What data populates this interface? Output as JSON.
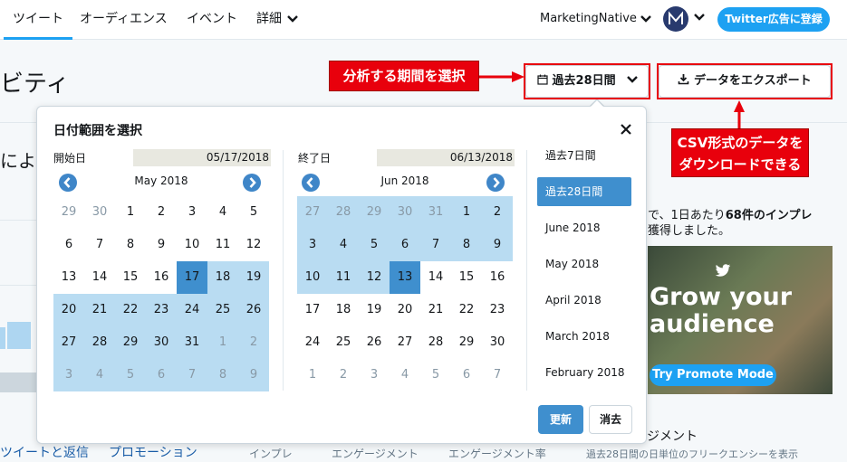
{
  "nav": {
    "tabs": [
      {
        "label": "ツイート"
      },
      {
        "label": "オーディエンス"
      },
      {
        "label": "イベント"
      },
      {
        "label": "詳細"
      }
    ],
    "account": "MarketingNative",
    "ads_button": "Twitter広告に登録"
  },
  "header": {
    "title_partial": "ビティ",
    "range_button": "過去28日間",
    "export_button": "データをエクスポート"
  },
  "callouts": {
    "period": "分析する期間を選択",
    "csv_line1": "CSV形式のデータを",
    "csv_line2": "ダウンロードできる"
  },
  "background": {
    "left_text": "によ",
    "right_line1_a": "で、1日あたり",
    "right_line1_b": "68件のインプレ",
    "right_line2": "獲得しました。",
    "promo_title": "Grow your audience",
    "promo_button": "Try Promote Mode",
    "engagement_partial": "ジメント",
    "bottom_tabs": [
      "ツイートと返信",
      "プロモーション"
    ],
    "bottom_headers": [
      "インプレ",
      "エンゲージメント",
      "エンゲージメント率"
    ],
    "bottom_right": "過去28日間の日単位のフリークエンシーを表示"
  },
  "picker": {
    "title": "日付範囲を選択",
    "start_label": "開始日",
    "start_value": "05/17/2018",
    "end_label": "終了日",
    "end_value": "06/13/2018",
    "start_month": "May 2018",
    "end_month": "Jun 2018",
    "start_days": [
      [
        {
          "d": "29",
          "out": true
        },
        {
          "d": "30",
          "out": true
        },
        {
          "d": "1"
        },
        {
          "d": "2"
        },
        {
          "d": "3"
        },
        {
          "d": "4"
        },
        {
          "d": "5"
        }
      ],
      [
        {
          "d": "6"
        },
        {
          "d": "7"
        },
        {
          "d": "8"
        },
        {
          "d": "9"
        },
        {
          "d": "10"
        },
        {
          "d": "11"
        },
        {
          "d": "12"
        }
      ],
      [
        {
          "d": "13"
        },
        {
          "d": "14"
        },
        {
          "d": "15"
        },
        {
          "d": "16"
        },
        {
          "d": "17",
          "sel": true
        },
        {
          "d": "18",
          "range": true
        },
        {
          "d": "19",
          "range": true
        }
      ],
      [
        {
          "d": "20",
          "range": true
        },
        {
          "d": "21",
          "range": true
        },
        {
          "d": "22",
          "range": true
        },
        {
          "d": "23",
          "range": true
        },
        {
          "d": "24",
          "range": true
        },
        {
          "d": "25",
          "range": true
        },
        {
          "d": "26",
          "range": true
        }
      ],
      [
        {
          "d": "27",
          "range": true
        },
        {
          "d": "28",
          "range": true
        },
        {
          "d": "29",
          "range": true
        },
        {
          "d": "30",
          "range": true
        },
        {
          "d": "31",
          "range": true
        },
        {
          "d": "1",
          "out": true,
          "range": true
        },
        {
          "d": "2",
          "out": true,
          "range": true
        }
      ],
      [
        {
          "d": "3",
          "out": true,
          "range": true
        },
        {
          "d": "4",
          "out": true,
          "range": true
        },
        {
          "d": "5",
          "out": true,
          "range": true
        },
        {
          "d": "6",
          "out": true,
          "range": true
        },
        {
          "d": "7",
          "out": true,
          "range": true
        },
        {
          "d": "8",
          "out": true,
          "range": true
        },
        {
          "d": "9",
          "out": true,
          "range": true
        }
      ]
    ],
    "end_days": [
      [
        {
          "d": "27",
          "out": true,
          "range": true
        },
        {
          "d": "28",
          "out": true,
          "range": true
        },
        {
          "d": "29",
          "out": true,
          "range": true
        },
        {
          "d": "30",
          "out": true,
          "range": true
        },
        {
          "d": "31",
          "out": true,
          "range": true
        },
        {
          "d": "1",
          "range": true
        },
        {
          "d": "2",
          "range": true
        }
      ],
      [
        {
          "d": "3",
          "range": true
        },
        {
          "d": "4",
          "range": true
        },
        {
          "d": "5",
          "range": true
        },
        {
          "d": "6",
          "range": true
        },
        {
          "d": "7",
          "range": true
        },
        {
          "d": "8",
          "range": true
        },
        {
          "d": "9",
          "range": true
        }
      ],
      [
        {
          "d": "10",
          "range": true
        },
        {
          "d": "11",
          "range": true
        },
        {
          "d": "12",
          "range": true
        },
        {
          "d": "13",
          "sel": true
        },
        {
          "d": "14"
        },
        {
          "d": "15"
        },
        {
          "d": "16"
        }
      ],
      [
        {
          "d": "17"
        },
        {
          "d": "18"
        },
        {
          "d": "19"
        },
        {
          "d": "20"
        },
        {
          "d": "21"
        },
        {
          "d": "22"
        },
        {
          "d": "23"
        }
      ],
      [
        {
          "d": "24"
        },
        {
          "d": "25"
        },
        {
          "d": "26"
        },
        {
          "d": "27"
        },
        {
          "d": "28"
        },
        {
          "d": "29"
        },
        {
          "d": "30"
        }
      ],
      [
        {
          "d": "1",
          "out": true
        },
        {
          "d": "2",
          "out": true
        },
        {
          "d": "3",
          "out": true
        },
        {
          "d": "4",
          "out": true
        },
        {
          "d": "5",
          "out": true
        },
        {
          "d": "6",
          "out": true
        },
        {
          "d": "7",
          "out": true
        }
      ]
    ],
    "presets": [
      {
        "label": "過去7日間"
      },
      {
        "label": "過去28日間",
        "active": true
      },
      {
        "label": "June 2018"
      },
      {
        "label": "May 2018"
      },
      {
        "label": "April 2018"
      },
      {
        "label": "March 2018"
      },
      {
        "label": "February 2018"
      }
    ],
    "update_button": "更新",
    "clear_button": "消去"
  },
  "colors": {
    "accent": "#1da1f2",
    "selected": "#3f8fce",
    "range": "#b9dcf2",
    "callout": "#e8000c"
  }
}
